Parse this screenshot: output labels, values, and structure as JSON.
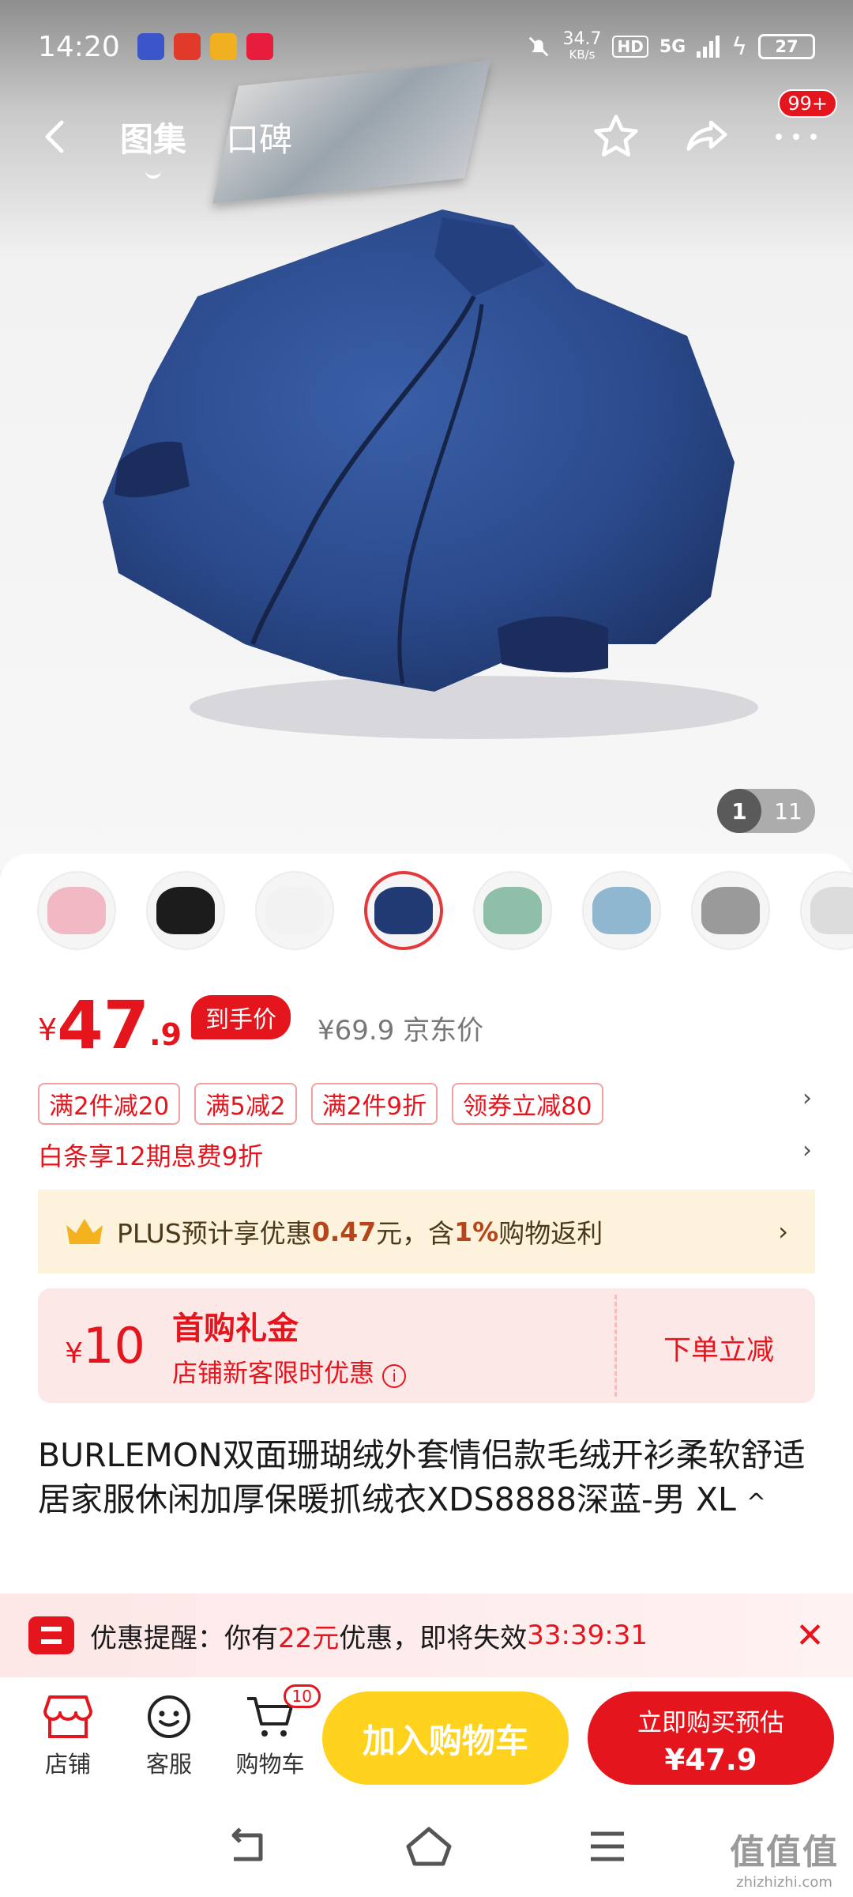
{
  "status_bar": {
    "time": "14:20",
    "net_speed": "34.7",
    "net_unit": "KB/s",
    "hd": "HD",
    "network": "5G",
    "battery": "27"
  },
  "nav": {
    "tabs": [
      "图集",
      "口碑"
    ],
    "badge": "99+"
  },
  "gallery": {
    "current": "1",
    "total": "11"
  },
  "thumb_colors": [
    "#f0b9c3",
    "#1c1c1c",
    "#f2f2f2",
    "#223a74",
    "#8fbfa8",
    "#8fb7cf",
    "#9a9a9a",
    "#dcdcdc"
  ],
  "price": {
    "currency": "¥",
    "integer": "47",
    "decimal": ".9",
    "tag": "到手价",
    "original": "¥69.9",
    "original_label": "京东价"
  },
  "coupons": [
    "满2件减20",
    "满5减2",
    "满2件9折",
    "领券立减80"
  ],
  "baitiao": "白条享12期息费9折",
  "plus": {
    "pre": "PLUS预计享优惠",
    "amount": "0.47",
    "mid": "元，含",
    "rate": "1%",
    "post": "购物返利"
  },
  "gift": {
    "currency": "¥",
    "value": "10",
    "title": "首购礼金",
    "subtitle": "店铺新客限时优惠",
    "action": "下单立减"
  },
  "product_title": "BURLEMON双面珊瑚绒外套情侣款毛绒开衫柔软舒适居家服休闲加厚保暖抓绒衣XDS8888深蓝-男 XL",
  "reminder": {
    "label": "优惠提醒：",
    "pre": "你有",
    "amount": "22元",
    "post": "优惠，即将失效",
    "countdown": "33:39:31"
  },
  "bottom_bar": {
    "shop": "店铺",
    "service": "客服",
    "cart": "购物车",
    "cart_count": "10",
    "add_to_cart": "加入购物车",
    "buy_now": "立即购买预估",
    "buy_price": "¥47.9"
  },
  "watermark": {
    "main": "值值值",
    "sub": "zhizhizhi.com"
  }
}
